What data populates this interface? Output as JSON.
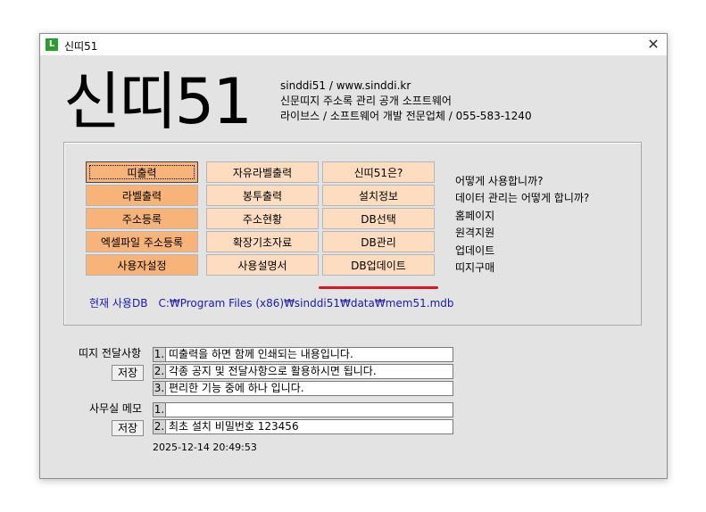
{
  "window": {
    "title": "신띠51",
    "app_icon": "L",
    "close": "✕"
  },
  "logo": "신띠51",
  "info": {
    "line1": "sinddi51 / www.sinddi.kr",
    "line2": "신문띠지 주소록 관리 공개 소프트웨어",
    "line3": "라이브스 / 소프트웨어 개발 전문업체 / 055-583-1240"
  },
  "buttons": {
    "col1": [
      "띠출력",
      "라벨출력",
      "주소등록",
      "엑셀파일 주소등록",
      "사용자설정"
    ],
    "col2": [
      "자유라벨출력",
      "봉투출력",
      "주소현황",
      "확장기초자료",
      "사용설명서"
    ],
    "col3": [
      "신띠51은?",
      "설치정보",
      "DB선택",
      "DB관리",
      "DB업데이트"
    ]
  },
  "help_links": [
    "어떻게 사용합니까?",
    "데이터 관리는 어떻게 합니까?",
    "홈페이지",
    "원격지원",
    "업데이트",
    "띠지구매"
  ],
  "db": {
    "label": "현재 사용DB",
    "path": "C:₩Program Files (x86)₩sinddi51₩data₩mem51.mdb"
  },
  "notice": {
    "label": "띠지 전달사항",
    "save": "저장",
    "rows": [
      {
        "num": "1.",
        "text": "띠출력을 하면 함께 인쇄되는 내용입니다."
      },
      {
        "num": "2.",
        "text": "각종 공지 및 전달사항으로 활용하시면 됩니다."
      },
      {
        "num": "3.",
        "text": "편리한 기능 중에 하나 입니다."
      }
    ]
  },
  "memo": {
    "label": "사무실 메모",
    "save": "저장",
    "rows": [
      {
        "num": "1.",
        "text": ""
      },
      {
        "num": "2.",
        "text": "최초 설치 비밀번호 123456"
      }
    ]
  },
  "timestamp": "2025-12-14  20:49:53",
  "colors": {
    "button_dark": "#f8b478",
    "button_light": "#fddcc0",
    "db_path": "#1a1aa8",
    "highlight": "#e0141e"
  }
}
